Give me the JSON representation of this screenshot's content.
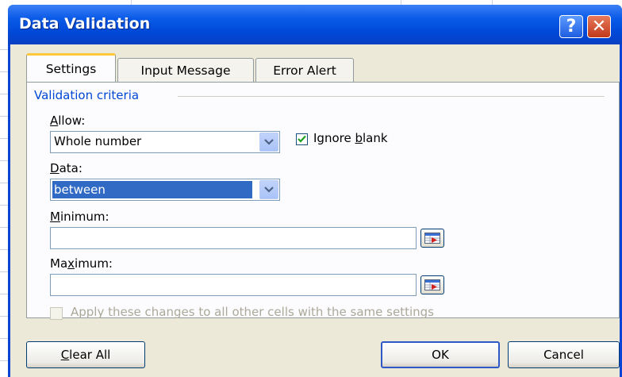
{
  "dialog": {
    "title": "Data Validation",
    "help_glyph": "?",
    "close_glyph": "✕"
  },
  "tabs": [
    {
      "label": "Settings",
      "active": true
    },
    {
      "label": "Input Message",
      "active": false
    },
    {
      "label": "Error Alert",
      "active": false
    }
  ],
  "settings": {
    "group_label": "Validation criteria",
    "allow": {
      "label_prefix": "",
      "label_key": "A",
      "label_rest": "llow:",
      "value": "Whole number"
    },
    "ignore_blank": {
      "label_pre": "Ignore ",
      "label_key": "b",
      "label_rest": "lank",
      "checked": true
    },
    "data": {
      "label_key": "D",
      "label_rest": "ata:",
      "value": "between"
    },
    "minimum": {
      "label_key": "M",
      "label_rest": "inimum:",
      "value": ""
    },
    "maximum": {
      "label_pre": "Ma",
      "label_key": "x",
      "label_rest": "imum:",
      "value": ""
    },
    "apply_all": {
      "label": "Apply these changes to all other cells with the same settings",
      "checked": false,
      "enabled": false
    }
  },
  "buttons": {
    "clear_all": {
      "key": "C",
      "rest": "lear All"
    },
    "ok": "OK",
    "cancel": "Cancel"
  },
  "colors": {
    "title_bar": "#0a5ae8",
    "group_label": "#0046d5",
    "selection": "#316ac5",
    "check_mark": "#21a121"
  },
  "icons": {
    "dropdown": "chevron-down-icon",
    "range_selector": "collapse-dialog-icon",
    "check": "checkmark-icon"
  }
}
